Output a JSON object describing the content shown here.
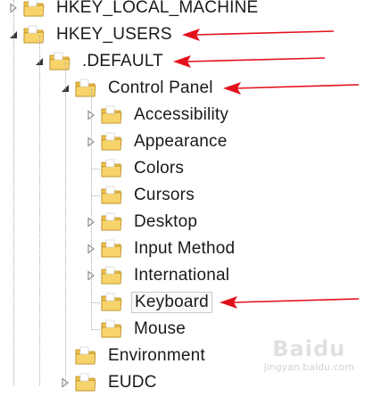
{
  "colors": {
    "arrow": "#e3101b",
    "folder_body": "#eec04a",
    "folder_front": "#f7d36b",
    "folder_edge": "#b8891e",
    "text": "#1a1a1a"
  },
  "tree": {
    "items": [
      {
        "label": "HKEY_LOCAL_MACHINE",
        "state": "collapsed",
        "level": 0,
        "icon": "folder-icon"
      },
      {
        "label": "HKEY_USERS",
        "state": "expanded",
        "level": 0,
        "icon": "folder-icon"
      },
      {
        "label": ".DEFAULT",
        "state": "expanded",
        "level": 1,
        "icon": "folder-icon"
      },
      {
        "label": "Control Panel",
        "state": "expanded",
        "level": 2,
        "icon": "folder-icon"
      },
      {
        "label": "Accessibility",
        "state": "collapsed",
        "level": 3,
        "icon": "folder-icon"
      },
      {
        "label": "Appearance",
        "state": "collapsed",
        "level": 3,
        "icon": "folder-icon"
      },
      {
        "label": "Colors",
        "state": "leaf",
        "level": 3,
        "icon": "folder-icon"
      },
      {
        "label": "Cursors",
        "state": "leaf",
        "level": 3,
        "icon": "folder-icon"
      },
      {
        "label": "Desktop",
        "state": "collapsed",
        "level": 3,
        "icon": "folder-icon"
      },
      {
        "label": "Input Method",
        "state": "collapsed",
        "level": 3,
        "icon": "folder-icon"
      },
      {
        "label": "International",
        "state": "collapsed",
        "level": 3,
        "icon": "folder-icon"
      },
      {
        "label": "Keyboard",
        "state": "leaf",
        "level": 3,
        "selected": true,
        "icon": "folder-icon"
      },
      {
        "label": "Mouse",
        "state": "leaf",
        "level": 3,
        "icon": "folder-icon"
      },
      {
        "label": "Environment",
        "state": "leaf",
        "level": 2,
        "icon": "folder-icon"
      },
      {
        "label": "EUDC",
        "state": "collapsed",
        "level": 2,
        "icon": "folder-icon"
      }
    ]
  },
  "annotations": {
    "arrows_point_to": [
      "HKEY_USERS",
      ".DEFAULT",
      "Control Panel",
      "Keyboard"
    ]
  },
  "watermark": {
    "brand": "Baidu",
    "domain": "jingyan.baidu.com"
  }
}
